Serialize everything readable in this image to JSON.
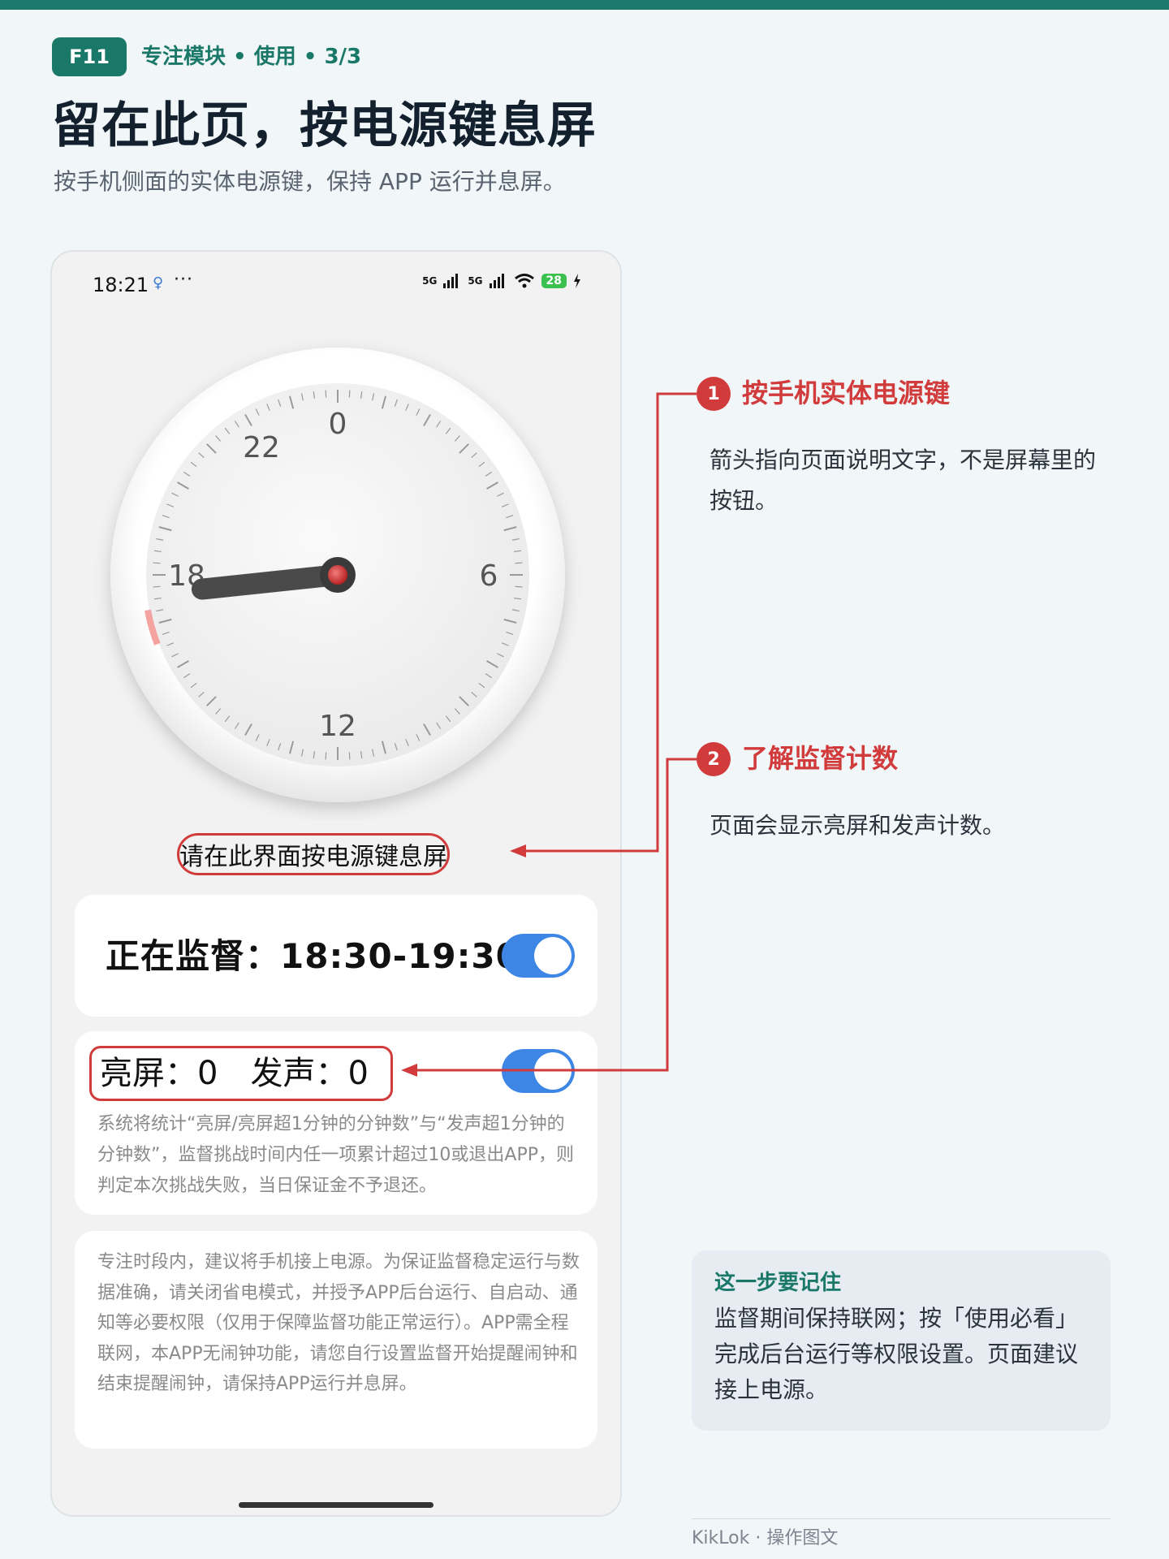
{
  "header": {
    "tag": "F11",
    "breadcrumb": "专注模块 • 使用 • 3/3",
    "title": "留在此页，按电源键息屏",
    "subtitle": "按手机侧面的实体电源键，保持 APP 运行并息屏。"
  },
  "phone": {
    "status": {
      "time": "18:21",
      "small_icon": "♀",
      "dots": "···",
      "signal1": "5G",
      "signal2": "5G",
      "battery": "28"
    },
    "clock": {
      "labels": [
        "0",
        "6",
        "12",
        "18",
        "22"
      ],
      "hand_hour": 17.6,
      "accent_color": "#f4a3a0"
    },
    "hint": "请在此界面按电源键息屏",
    "monitor": {
      "text": "正在监督：18:30-19:30",
      "enabled": true
    },
    "count": {
      "label": "亮屏：0　发声：0",
      "enabled": true,
      "desc": "系统将统计“亮屏/亮屏超1分钟的分钟数”与“发声超1分钟的分钟数”，监督挑战时间内任一项累计超过10或退出APP，则判定本次挑战失败，当日保证金不予退还。"
    },
    "tips": "专注时段内，建议将手机接上电源。为保证监督稳定运行与数据准确，请关闭省电模式，并授予APP后台运行、自启动、通知等必要权限（仅用于保障监督功能正常运行）。APP需全程联网，本APP无闹钟功能，请您自行设置监督开始提醒闹钟和结束提醒闹钟，请保持APP运行并息屏。"
  },
  "callouts": [
    {
      "num": "1",
      "title": "按手机实体电源键",
      "desc": "箭头指向页面说明文字，不是屏幕里的按钮。"
    },
    {
      "num": "2",
      "title": "了解监督计数",
      "desc": "页面会显示亮屏和发声计数。"
    }
  ],
  "note": {
    "title": "这一步要记住",
    "body": "监督期间保持联网；按「使用必看」完成后台运行等权限设置。页面建议接上电源。"
  },
  "footer": "KikLok · 操作图文",
  "colors": {
    "accent": "#1a7868",
    "callout": "#d13b3b",
    "toggle": "#3e86e6"
  }
}
